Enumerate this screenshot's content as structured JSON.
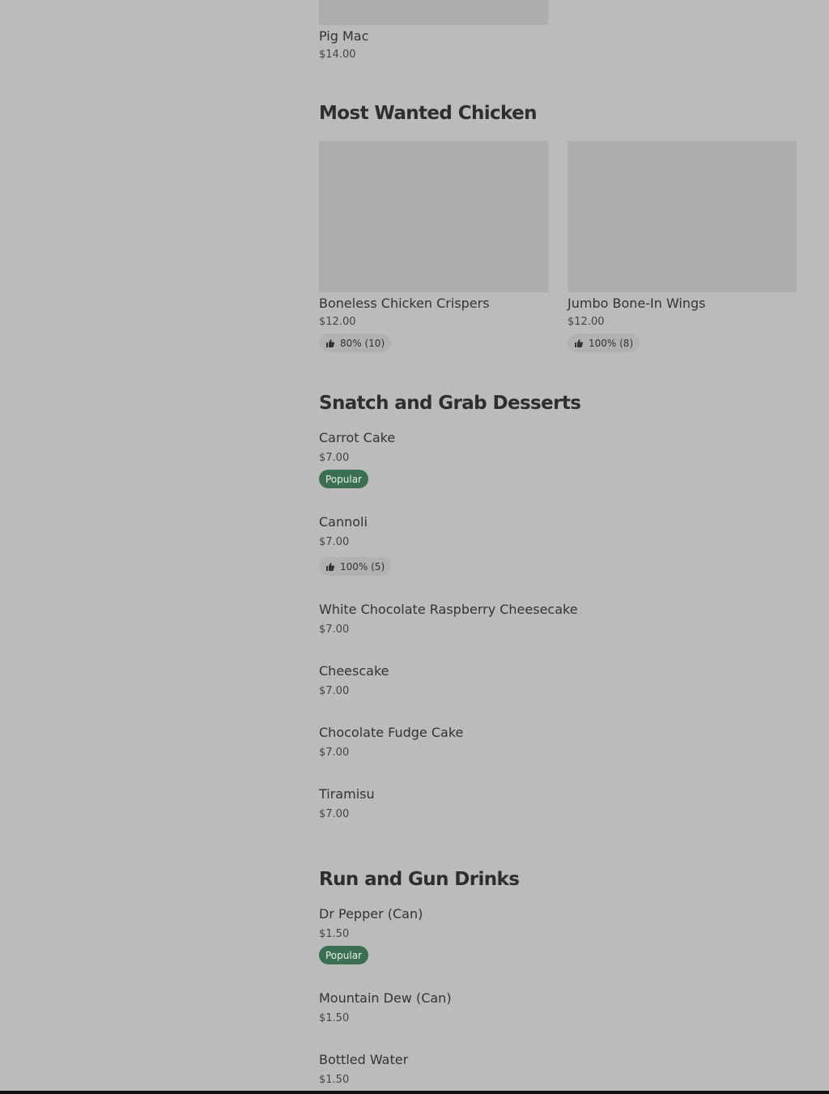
{
  "top_item": {
    "name": "Pig Mac",
    "price": "$14.00"
  },
  "sections": [
    {
      "title": "Most Wanted Chicken",
      "items": [
        {
          "name": "Boneless Chicken Crispers",
          "price": "$12.00",
          "rating": "80% (10)"
        },
        {
          "name": "Jumbo Bone-In Wings",
          "price": "$12.00",
          "rating": "100% (8)"
        }
      ]
    },
    {
      "title": "Snatch and Grab Desserts",
      "items": [
        {
          "name": "Carrot Cake",
          "price": "$7.00",
          "badge": "Popular"
        },
        {
          "name": "Cannoli",
          "price": "$7.00",
          "rating": "100% (5)"
        },
        {
          "name": "White Chocolate Raspberry Cheesecake",
          "price": "$7.00"
        },
        {
          "name": "Cheescake",
          "price": "$7.00"
        },
        {
          "name": "Chocolate Fudge Cake",
          "price": "$7.00"
        },
        {
          "name": "Tiramisu",
          "price": "$7.00"
        }
      ]
    },
    {
      "title": "Run and Gun Drinks",
      "items": [
        {
          "name": "Dr Pepper (Can)",
          "price": "$1.50",
          "badge": "Popular"
        },
        {
          "name": "Mountain Dew (Can)",
          "price": "$1.50"
        },
        {
          "name": "Bottled Water",
          "price": "$1.50"
        }
      ]
    }
  ],
  "icons": {
    "rating": "thumbs-up-icon"
  },
  "colors": {
    "background": "#bbbbbb",
    "popular_badge": "#3a6f52",
    "rating_pill": "#b1b1b1"
  }
}
